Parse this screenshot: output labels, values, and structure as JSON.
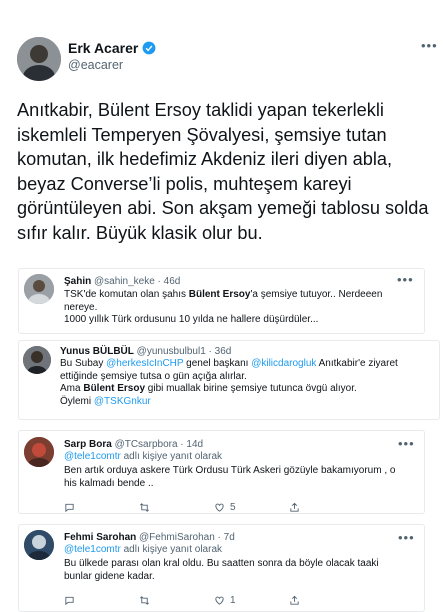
{
  "main_tweet": {
    "name": "Erk Acarer",
    "handle": "@eacarer",
    "text": "Anıtkabir, Bülent Ersoy taklidi yapan tekerlekli iskemleli Temperyen Şövalyesi, şemsiye tutan komutan, ilk hedefimiz Akdeniz ileri diyen abla, beyaz Converse’li polis, muhteşem kareyi görüntüleyen abi. Son akşam yemeği tablosu solda sıfır kalır. Büyük klasik olur bu."
  },
  "cards": [
    {
      "name": "Şahin",
      "handle_time": "@sahin_keke · 46d",
      "text_before": "TSK'de komutan olan şahıs ",
      "bold": "Bülent Ersoy",
      "text_after": "'a şemsiye tutuyor.. Nerdeeen nereye.",
      "line2": "1000 yıllık Türk ordusunu 10 yılda ne hallere düşürdüler..."
    },
    {
      "name": "Yunus BÜLBÜL",
      "handle_time": "@yunusbulbul1 · 36d",
      "t1": "Bu Subay ",
      "m1": "@herkesIcInCHP",
      "t2": " genel başkanı ",
      "m2": "@kilicdarogluk",
      "t3": " Anıtkabir'e ziyaret ettiğinde şemsiye tutsa o gün açığa alırlar.",
      "t4": "Ama ",
      "bold": "Bülent Ersoy",
      "t5": " gibi muallak birine şemsiye tutunca övgü alıyor.",
      "t6": "Öylemi ",
      "m3": "@TSKGnkur"
    },
    {
      "name": "Sarp Bora",
      "handle_time": "@TCsarpbora · 14d",
      "reply_mention": "@tele1comtr",
      "reply_text": " adlı kişiye yanıt olarak",
      "text": "Ben artık orduya askere Türk Ordusu Türk Askeri gözüyle bakamıyorum , o his kalmadı bende ..",
      "like_count": "5"
    },
    {
      "name": "Fehmi Sarohan",
      "handle_time": "@FehmiSarohan · 7d",
      "reply_mention": "@tele1comtr",
      "reply_text": " adlı kişiye yanıt olarak",
      "text": "Bu ülkede parası olan kral oldu. Bu saatten sonra da böyle olacak taaki bunlar gidene kadar.",
      "like_count": "1"
    }
  ],
  "icons": {
    "verified": "verified-badge-icon",
    "more": "more-dots-icon",
    "reply": "reply-icon",
    "retweet": "retweet-icon",
    "like": "like-icon",
    "share": "share-icon"
  },
  "colors": {
    "accent": "#1d9bf0",
    "muted": "#536471",
    "text": "#0f1419"
  }
}
